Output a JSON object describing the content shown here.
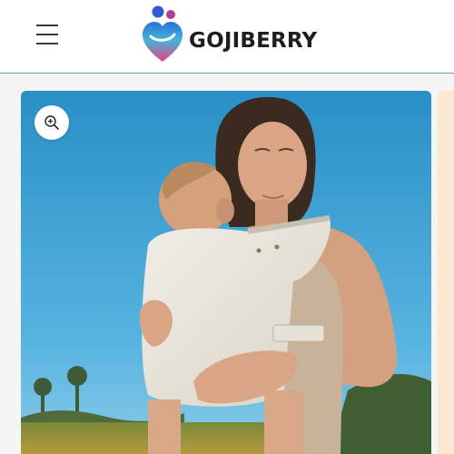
{
  "header": {
    "brand": "GOJIBERRY",
    "menu_icon": "hamburger-menu-icon",
    "logo_icon": "heart-figures-logo",
    "border_color": "#6b9fa6"
  },
  "gallery": {
    "zoom_icon": "zoom-in-icon",
    "image_subject": "photo"
  },
  "colors": {
    "brand_blue": "#2f5bd6",
    "brand_pink": "#e0457f",
    "brand_magenta": "#9b3aa0",
    "sky": "#2f97c9"
  }
}
